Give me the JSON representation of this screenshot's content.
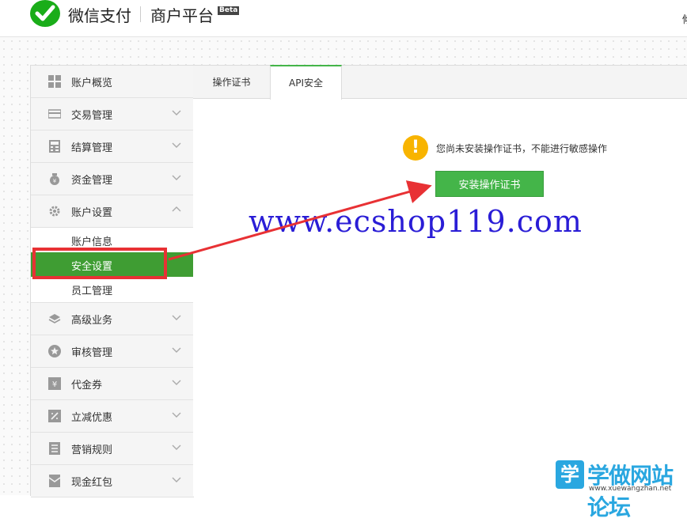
{
  "header": {
    "brand": "微信支付",
    "platform": "商户平台",
    "beta": "Beta",
    "user_initial": "傾"
  },
  "sidebar": {
    "items": [
      {
        "label": "账户概览",
        "icon": "grid-icon",
        "chevron": ""
      },
      {
        "label": "交易管理",
        "icon": "card-icon",
        "chevron": "down"
      },
      {
        "label": "结算管理",
        "icon": "calculator-icon",
        "chevron": "down"
      },
      {
        "label": "资金管理",
        "icon": "money-bag-icon",
        "chevron": "down"
      },
      {
        "label": "账户设置",
        "icon": "gear-icon",
        "chevron": "up"
      }
    ],
    "subitems": [
      {
        "label": "账户信息"
      },
      {
        "label": "安全设置",
        "active": true
      },
      {
        "label": "员工管理"
      }
    ],
    "items_after": [
      {
        "label": "高级业务",
        "icon": "layers-icon",
        "chevron": "down"
      },
      {
        "label": "审核管理",
        "icon": "star-icon",
        "chevron": "down"
      },
      {
        "label": "代金券",
        "icon": "yen-icon",
        "chevron": "down"
      },
      {
        "label": "立减优惠",
        "icon": "discount-icon",
        "chevron": "down"
      },
      {
        "label": "营销规则",
        "icon": "document-icon",
        "chevron": "down"
      },
      {
        "label": "现金红包",
        "icon": "red-packet-icon",
        "chevron": "down"
      }
    ]
  },
  "tabs": [
    {
      "label": "操作证书",
      "active": false
    },
    {
      "label": "API安全",
      "active": true
    }
  ],
  "content": {
    "notice": "您尚未安装操作证书，不能进行敏感操作",
    "install_button": "安装操作证书",
    "warning_mark": "!"
  },
  "overlay": {
    "watermark": "www.ecshop119.com",
    "site_badge": "学",
    "site_name": "学做网站论坛",
    "site_url": "www.xuewangzhan.net"
  },
  "colors": {
    "accent": "#44b549",
    "active_item": "#3f9d33",
    "warning": "#f8b400",
    "highlight": "#e83134",
    "watermark": "#2a1dd6"
  }
}
